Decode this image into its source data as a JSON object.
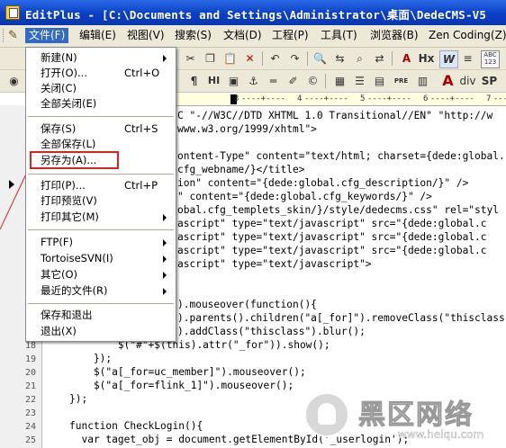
{
  "window": {
    "title": "EditPlus - [C:\\Documents and Settings\\Administrator\\桌面\\DedeCMS-V5"
  },
  "menubar": {
    "items": [
      {
        "label": "文件(F)"
      },
      {
        "label": "编辑(E)"
      },
      {
        "label": "视图(V)"
      },
      {
        "label": "搜索(S)"
      },
      {
        "label": "文档(D)"
      },
      {
        "label": "工程(P)"
      },
      {
        "label": "工具(T)"
      },
      {
        "label": "浏览器(B)"
      },
      {
        "label": "Zen Coding(Z)"
      }
    ]
  },
  "toolbar2": {
    "pre": "PRE",
    "div": "div",
    "sp": "SP",
    "h": "H",
    "abc": "ABC"
  },
  "ruler": {
    "marks": [
      "1",
      "2",
      "3",
      "4",
      "5",
      "6",
      "7"
    ]
  },
  "file_menu": {
    "items": [
      {
        "label": "新建(N)",
        "shortcut": "",
        "submenu": true
      },
      {
        "label": "打开(O)...",
        "shortcut": "Ctrl+O",
        "submenu": false
      },
      {
        "label": "关闭(C)",
        "shortcut": "",
        "submenu": false
      },
      {
        "label": "全部关闭(E)",
        "shortcut": "",
        "submenu": false
      },
      {
        "label": "保存(S)",
        "shortcut": "Ctrl+S",
        "submenu": false
      },
      {
        "label": "全部保存(L)",
        "shortcut": "",
        "submenu": false
      },
      {
        "label": "另存为(A)...",
        "shortcut": "",
        "submenu": false
      },
      {
        "label": "打印(P)...",
        "shortcut": "Ctrl+P",
        "submenu": false
      },
      {
        "label": "打印预览(V)",
        "shortcut": "",
        "submenu": false
      },
      {
        "label": "打印其它(M)",
        "shortcut": "",
        "submenu": true
      },
      {
        "label": "FTP(F)",
        "shortcut": "",
        "submenu": true
      },
      {
        "label": "TortoiseSVN(I)",
        "shortcut": "",
        "submenu": true
      },
      {
        "label": "其它(O)",
        "shortcut": "",
        "submenu": true
      },
      {
        "label": "最近的文件(R)",
        "shortcut": "",
        "submenu": true
      },
      {
        "label": "保存和退出",
        "shortcut": "",
        "submenu": false
      },
      {
        "label": "退出(X)",
        "shortcut": "",
        "submenu": false
      }
    ]
  },
  "editor": {
    "visible_line_numbers": [
      "18",
      "19",
      "20",
      "21",
      "22",
      "23",
      "24",
      "25"
    ],
    "code_lines": [
      "C \"-//W3C//DTD XHTML 1.0 Transitional//EN\" \"http://w",
      "www.w3.org/1999/xhtml\">",
      "",
      "ontent-Type\" content=\"text/html; charset={dede:global.",
      "cfg_webname/}</title>",
      "ion\" content=\"{dede:global.cfg_description/}\" />",
      "\" content=\"{dede:global.cfg_keywords/}\" />",
      "obal.cfg_templets_skin/}/style/dedecms.css\" rel=\"styl",
      "ascript\" type=\"text/javascript\" src=\"{dede:global.c",
      "ascript\" type=\"text/javascript\" src=\"{dede:global.c",
      "ascript\" type=\"text/javascript\" src=\"{dede:global.c",
      "ascript\" type=\"text/javascript\">",
      "",
      "",
      ").mouseover(function(){",
      ").parents().children(\"a[_for]\").removeClass(\"thisclass\"",
      ").addClass(\"thisclass\").blur();",
      "        $(\"#\"+$(this).attr(\"_for\")).show();",
      "    });",
      "    $(\"a[_for=uc_member]\").mouseover();",
      "    $(\"a[_for=flink_1]\").mouseover();",
      "});",
      "",
      "function CheckLogin(){",
      "  var taget_obj = document.getElementById('_userlogin');"
    ]
  },
  "watermark": {
    "text": "黑区网络",
    "url": "www.heiqu.com"
  }
}
